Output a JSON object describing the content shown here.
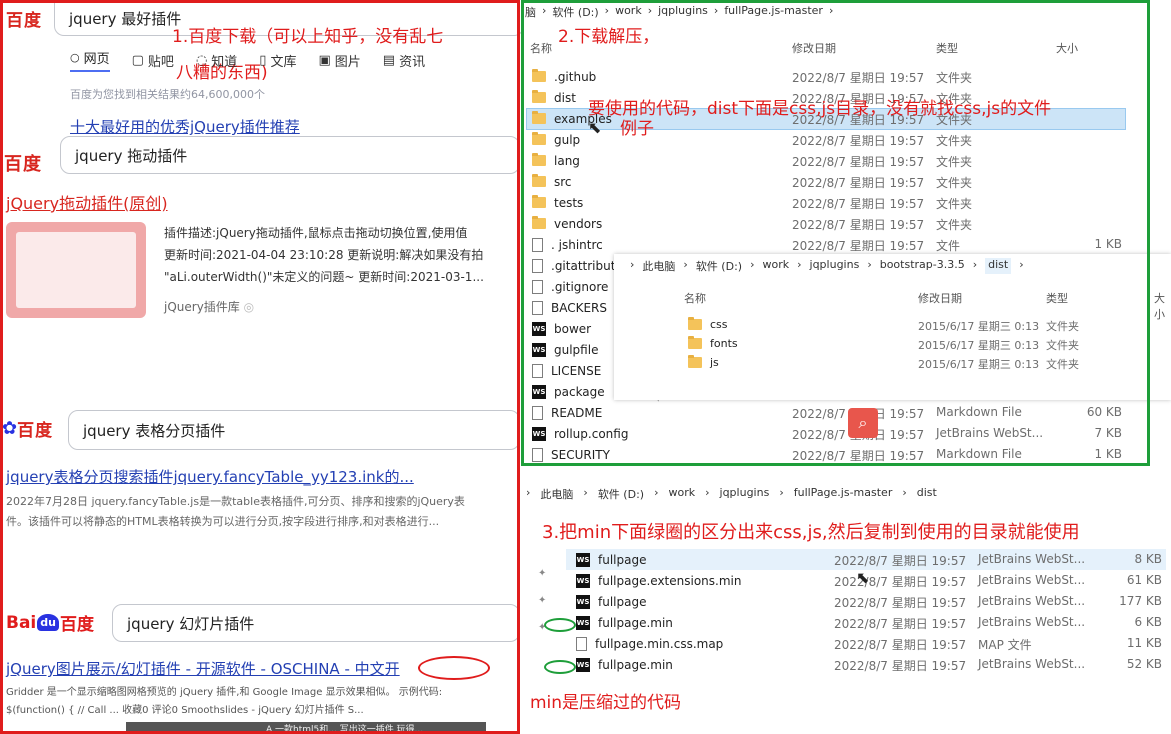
{
  "left": {
    "s1": {
      "logo": "百度",
      "query": "jquery 最好插件",
      "annotation1": "1.百度下载（可以上知乎，没有乱七",
      "annotation2": "八糟的东西)",
      "tabs": [
        "网页",
        "贴吧",
        "知道",
        "文库",
        "图片",
        "资讯"
      ],
      "result_count": "百度为您找到相关结果约64,600,000个",
      "result_title": "十大最好用的优秀jQuery插件推荐"
    },
    "s2": {
      "logo": "百度",
      "query": "jquery 拖动插件",
      "result_title": "jQuery拖动插件(原创)",
      "desc1": "插件描述:jQuery拖动插件,鼠标点击拖动切换位置,使用值",
      "desc2": "更新时间:2021-04-04 23:10:28 更新说明:解决如果没有拍",
      "desc3": "\"aLi.outerWidth()\"未定义的问题~ 更新时间:2021-03-1...",
      "source": "jQuery插件库"
    },
    "s3": {
      "logo": "百度",
      "query": "jquery 表格分页插件",
      "result_title": "jquery表格分页搜索插件jquery.fancyTable_yy123.ink的...",
      "desc1": "2022年7月28日 jquery.fancyTable.js是一款table表格插件,可分页、排序和搜索的jQuery表",
      "desc2": "件。该插件可以将静态的HTML表格转换为可以进行分页,按字段进行排序,和对表格进行..."
    },
    "s4": {
      "logo_bai": "Bai",
      "logo_du": "du",
      "logo_cn": "百度",
      "query": "jquery 幻灯片插件",
      "result_title": "jQuery图片展示/幻灯插件 - 开源软件 - OSCHINA - 中文开",
      "desc1": "Gridder 是一个显示缩略图网格预览的 jQuery 插件,和 Google Image 显示效果相似。 示例代码:",
      "desc2": "$(function() { // Call ... 收藏0 评论0 Smoothslides - jQuery 幻灯片插件 S...",
      "desc3": "A 一款html5和... 写出这一插件 玩得..."
    }
  },
  "explorer1": {
    "breadcrumb": [
      "脑",
      "软件 (D:)",
      "work",
      "jqplugins",
      "fullPage.js-master"
    ],
    "annotation": "2.下载解压，",
    "headers": {
      "name": "名称",
      "date": "修改日期",
      "type": "类型",
      "size": "大小"
    },
    "rows": [
      {
        "icon": "folder",
        "name": ".github",
        "date": "2022/8/7 星期日 19:57",
        "type": "文件夹",
        "size": ""
      },
      {
        "icon": "folder",
        "name": "dist",
        "date": "2022/8/7 星期日 19:57",
        "type": "文件夹",
        "size": ""
      },
      {
        "icon": "folder",
        "name": "examples",
        "date": "2022/8/7 星期日 19:57",
        "type": "文件夹",
        "size": ""
      },
      {
        "icon": "folder",
        "name": "gulp",
        "date": "2022/8/7 星期日 19:57",
        "type": "文件夹",
        "size": ""
      },
      {
        "icon": "folder",
        "name": "lang",
        "date": "2022/8/7 星期日 19:57",
        "type": "文件夹",
        "size": ""
      },
      {
        "icon": "folder",
        "name": "src",
        "date": "2022/8/7 星期日 19:57",
        "type": "文件夹",
        "size": ""
      },
      {
        "icon": "folder",
        "name": "tests",
        "date": "2022/8/7 星期日 19:57",
        "type": "文件夹",
        "size": ""
      },
      {
        "icon": "folder",
        "name": "vendors",
        "date": "2022/8/7 星期日 19:57",
        "type": "文件夹",
        "size": ""
      },
      {
        "icon": "file",
        "name": ". jshintrc",
        "date": "2022/8/7 星期日 19:57",
        "type": "文件",
        "size": "1 KB"
      },
      {
        "icon": "file",
        "name": ".gitattributes",
        "date": "",
        "type": "",
        "size": ""
      },
      {
        "icon": "file",
        "name": ".gitignore",
        "date": "",
        "type": "",
        "size": ""
      },
      {
        "icon": "file",
        "name": "BACKERS",
        "date": "",
        "type": "",
        "size": ""
      },
      {
        "icon": "ws",
        "name": "bower",
        "date": "",
        "type": "",
        "size": ""
      },
      {
        "icon": "ws",
        "name": "gulpfile",
        "date": "",
        "type": "",
        "size": ""
      },
      {
        "icon": "file",
        "name": "LICENSE",
        "date": "",
        "type": "",
        "size": ""
      },
      {
        "icon": "ws",
        "name": "package",
        "date": "",
        "type": "",
        "size": ""
      },
      {
        "icon": "file",
        "name": "README",
        "date": "2022/8/7 星期日 19:57",
        "type": "Markdown File",
        "size": "60 KB"
      },
      {
        "icon": "ws",
        "name": "rollup.config",
        "date": "2022/8/7 星期日 19:57",
        "type": "JetBrains WebSt...",
        "size": "7 KB"
      },
      {
        "icon": "file",
        "name": "SECURITY",
        "date": "2022/8/7 星期日 19:57",
        "type": "Markdown File",
        "size": "1 KB"
      }
    ],
    "annot_code": "要使用的代码，dist下面是css,js目录，没有就找css,js的文件",
    "annot_example": "例子"
  },
  "explorer2": {
    "breadcrumb": [
      "此电脑",
      "软件 (D:)",
      "work",
      "jqplugins",
      "bootstrap-3.3.5",
      "dist"
    ],
    "headers": {
      "name": "名称",
      "date": "修改日期",
      "type": "类型",
      "size": "大小"
    },
    "rows": [
      {
        "name": "css",
        "date": "2015/6/17 星期三 0:13",
        "type": "文件夹"
      },
      {
        "name": "fonts",
        "date": "2015/6/17 星期三 0:13",
        "type": "文件夹"
      },
      {
        "name": "js",
        "date": "2015/6/17 星期三 0:13",
        "type": "文件夹"
      }
    ]
  },
  "explorer3": {
    "breadcrumb": [
      "此电脑",
      "软件 (D:)",
      "work",
      "jqplugins",
      "fullPage.js-master",
      "dist"
    ],
    "annotation": "3.把min下面绿圈的区分出来css,js,然后复制到使用的目录就能使用",
    "rows": [
      {
        "icon": "ws",
        "name": "fullpage",
        "date": "2022/8/7 星期日 19:57",
        "type": "JetBrains WebSt...",
        "size": "8 KB"
      },
      {
        "icon": "ws",
        "name": "fullpage.extensions.min",
        "date": "2022/8/7 星期日 19:57",
        "type": "JetBrains WebSt...",
        "size": "61 KB"
      },
      {
        "icon": "ws",
        "name": "fullpage",
        "date": "2022/8/7 星期日 19:57",
        "type": "JetBrains WebSt...",
        "size": "177 KB"
      },
      {
        "icon": "ws",
        "name": "fullpage.min",
        "date": "2022/8/7 星期日 19:57",
        "type": "JetBrains WebSt...",
        "size": "6 KB"
      },
      {
        "icon": "file",
        "name": "fullpage.min.css.map",
        "date": "2022/8/7 星期日 19:57",
        "type": "MAP 文件",
        "size": "11 KB"
      },
      {
        "icon": "ws",
        "name": "fullpage.min",
        "date": "2022/8/7 星期日 19:57",
        "type": "JetBrains WebSt...",
        "size": "52 KB"
      }
    ],
    "annot_min": "min是压缩过的代码"
  },
  "colors": {
    "annotation_red": "#e01c1c",
    "frame_green": "#1e9e3a",
    "baidu_red": "#d8261f",
    "link_blue": "#2440b3"
  }
}
